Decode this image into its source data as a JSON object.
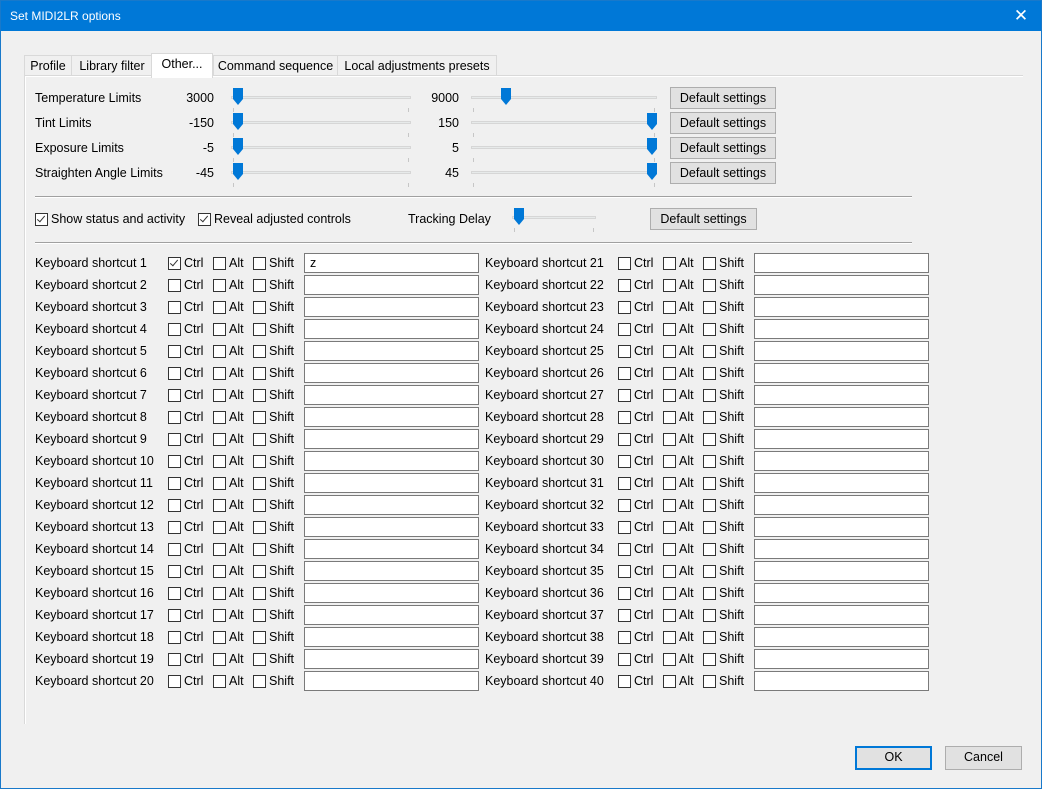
{
  "window": {
    "title": "Set MIDI2LR options",
    "close_glyph": "✕"
  },
  "tabs": [
    {
      "label": "Profile"
    },
    {
      "label": "Library filter"
    },
    {
      "label": "Other..."
    },
    {
      "label": "Command sequence"
    },
    {
      "label": "Local adjustments presets"
    }
  ],
  "limits": [
    {
      "label": "Temperature Limits",
      "min": "3000",
      "max": "9000",
      "min_pos": 0.0,
      "max_pos": 0.16,
      "button": "Default settings"
    },
    {
      "label": "Tint Limits",
      "min": "-150",
      "max": "150",
      "min_pos": 0.0,
      "max_pos": 1.0,
      "button": "Default settings"
    },
    {
      "label": "Exposure Limits",
      "min": "-5",
      "max": "5",
      "min_pos": 0.0,
      "max_pos": 1.0,
      "button": "Default settings"
    },
    {
      "label": "Straighten Angle Limits",
      "min": "-45",
      "max": "45",
      "min_pos": 0.0,
      "max_pos": 1.0,
      "button": "Default settings"
    }
  ],
  "options": {
    "show_status": {
      "label": "Show status and activity",
      "checked": true
    },
    "reveal_adjusted": {
      "label": "Reveal adjusted controls",
      "checked": true
    },
    "tracking_delay_label": "Tracking Delay",
    "tracking_delay_pos": 0.0,
    "button": "Default settings"
  },
  "modifiers": {
    "ctrl": "Ctrl",
    "alt": "Alt",
    "shift": "Shift"
  },
  "shortcuts": [
    {
      "label": "Keyboard shortcut 1",
      "ctrl": true,
      "alt": false,
      "shift": false,
      "key": "z"
    },
    {
      "label": "Keyboard shortcut 2",
      "ctrl": false,
      "alt": false,
      "shift": false,
      "key": ""
    },
    {
      "label": "Keyboard shortcut 3",
      "ctrl": false,
      "alt": false,
      "shift": false,
      "key": ""
    },
    {
      "label": "Keyboard shortcut 4",
      "ctrl": false,
      "alt": false,
      "shift": false,
      "key": ""
    },
    {
      "label": "Keyboard shortcut 5",
      "ctrl": false,
      "alt": false,
      "shift": false,
      "key": ""
    },
    {
      "label": "Keyboard shortcut 6",
      "ctrl": false,
      "alt": false,
      "shift": false,
      "key": ""
    },
    {
      "label": "Keyboard shortcut 7",
      "ctrl": false,
      "alt": false,
      "shift": false,
      "key": ""
    },
    {
      "label": "Keyboard shortcut 8",
      "ctrl": false,
      "alt": false,
      "shift": false,
      "key": ""
    },
    {
      "label": "Keyboard shortcut 9",
      "ctrl": false,
      "alt": false,
      "shift": false,
      "key": ""
    },
    {
      "label": "Keyboard shortcut 10",
      "ctrl": false,
      "alt": false,
      "shift": false,
      "key": ""
    },
    {
      "label": "Keyboard shortcut 11",
      "ctrl": false,
      "alt": false,
      "shift": false,
      "key": ""
    },
    {
      "label": "Keyboard shortcut 12",
      "ctrl": false,
      "alt": false,
      "shift": false,
      "key": ""
    },
    {
      "label": "Keyboard shortcut 13",
      "ctrl": false,
      "alt": false,
      "shift": false,
      "key": ""
    },
    {
      "label": "Keyboard shortcut 14",
      "ctrl": false,
      "alt": false,
      "shift": false,
      "key": ""
    },
    {
      "label": "Keyboard shortcut 15",
      "ctrl": false,
      "alt": false,
      "shift": false,
      "key": ""
    },
    {
      "label": "Keyboard shortcut 16",
      "ctrl": false,
      "alt": false,
      "shift": false,
      "key": ""
    },
    {
      "label": "Keyboard shortcut 17",
      "ctrl": false,
      "alt": false,
      "shift": false,
      "key": ""
    },
    {
      "label": "Keyboard shortcut 18",
      "ctrl": false,
      "alt": false,
      "shift": false,
      "key": ""
    },
    {
      "label": "Keyboard shortcut 19",
      "ctrl": false,
      "alt": false,
      "shift": false,
      "key": ""
    },
    {
      "label": "Keyboard shortcut 20",
      "ctrl": false,
      "alt": false,
      "shift": false,
      "key": ""
    },
    {
      "label": "Keyboard shortcut 21",
      "ctrl": false,
      "alt": false,
      "shift": false,
      "key": ""
    },
    {
      "label": "Keyboard shortcut 22",
      "ctrl": false,
      "alt": false,
      "shift": false,
      "key": ""
    },
    {
      "label": "Keyboard shortcut 23",
      "ctrl": false,
      "alt": false,
      "shift": false,
      "key": ""
    },
    {
      "label": "Keyboard shortcut 24",
      "ctrl": false,
      "alt": false,
      "shift": false,
      "key": ""
    },
    {
      "label": "Keyboard shortcut 25",
      "ctrl": false,
      "alt": false,
      "shift": false,
      "key": ""
    },
    {
      "label": "Keyboard shortcut 26",
      "ctrl": false,
      "alt": false,
      "shift": false,
      "key": ""
    },
    {
      "label": "Keyboard shortcut 27",
      "ctrl": false,
      "alt": false,
      "shift": false,
      "key": ""
    },
    {
      "label": "Keyboard shortcut 28",
      "ctrl": false,
      "alt": false,
      "shift": false,
      "key": ""
    },
    {
      "label": "Keyboard shortcut 29",
      "ctrl": false,
      "alt": false,
      "shift": false,
      "key": ""
    },
    {
      "label": "Keyboard shortcut 30",
      "ctrl": false,
      "alt": false,
      "shift": false,
      "key": ""
    },
    {
      "label": "Keyboard shortcut 31",
      "ctrl": false,
      "alt": false,
      "shift": false,
      "key": ""
    },
    {
      "label": "Keyboard shortcut 32",
      "ctrl": false,
      "alt": false,
      "shift": false,
      "key": ""
    },
    {
      "label": "Keyboard shortcut 33",
      "ctrl": false,
      "alt": false,
      "shift": false,
      "key": ""
    },
    {
      "label": "Keyboard shortcut 34",
      "ctrl": false,
      "alt": false,
      "shift": false,
      "key": ""
    },
    {
      "label": "Keyboard shortcut 35",
      "ctrl": false,
      "alt": false,
      "shift": false,
      "key": ""
    },
    {
      "label": "Keyboard shortcut 36",
      "ctrl": false,
      "alt": false,
      "shift": false,
      "key": ""
    },
    {
      "label": "Keyboard shortcut 37",
      "ctrl": false,
      "alt": false,
      "shift": false,
      "key": ""
    },
    {
      "label": "Keyboard shortcut 38",
      "ctrl": false,
      "alt": false,
      "shift": false,
      "key": ""
    },
    {
      "label": "Keyboard shortcut 39",
      "ctrl": false,
      "alt": false,
      "shift": false,
      "key": ""
    },
    {
      "label": "Keyboard shortcut 40",
      "ctrl": false,
      "alt": false,
      "shift": false,
      "key": ""
    }
  ],
  "footer": {
    "ok_label": "OK",
    "cancel_label": "Cancel"
  },
  "colors": {
    "accent": "#0078d7",
    "titlebar": "#0078d7",
    "background": "#f0f0f0"
  }
}
